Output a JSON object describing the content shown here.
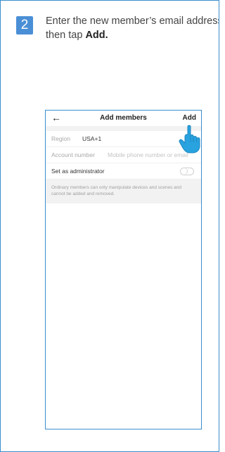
{
  "step": {
    "number": "2",
    "line1": "Enter the new member’s email address,",
    "line2_prefix": "then tap ",
    "line2_bold": "Add."
  },
  "phone_screen": {
    "header": {
      "back_icon": "back-arrow-icon",
      "title": "Add members",
      "add_label": "Add"
    },
    "region": {
      "label": "Region",
      "value": "USA+1"
    },
    "account": {
      "label": "Account number",
      "placeholder": "Mobile phone number or email"
    },
    "admin": {
      "label": "Set as administrator",
      "toggle_on": false
    },
    "note": "Ordinary members can only manipulate devices and scenes and cannot be added and removed."
  },
  "colors": {
    "accent_blue": "#4a8fd6",
    "hand_cyan": "#29a3e0"
  },
  "icons": {
    "pointer": "tap-hand-icon"
  }
}
